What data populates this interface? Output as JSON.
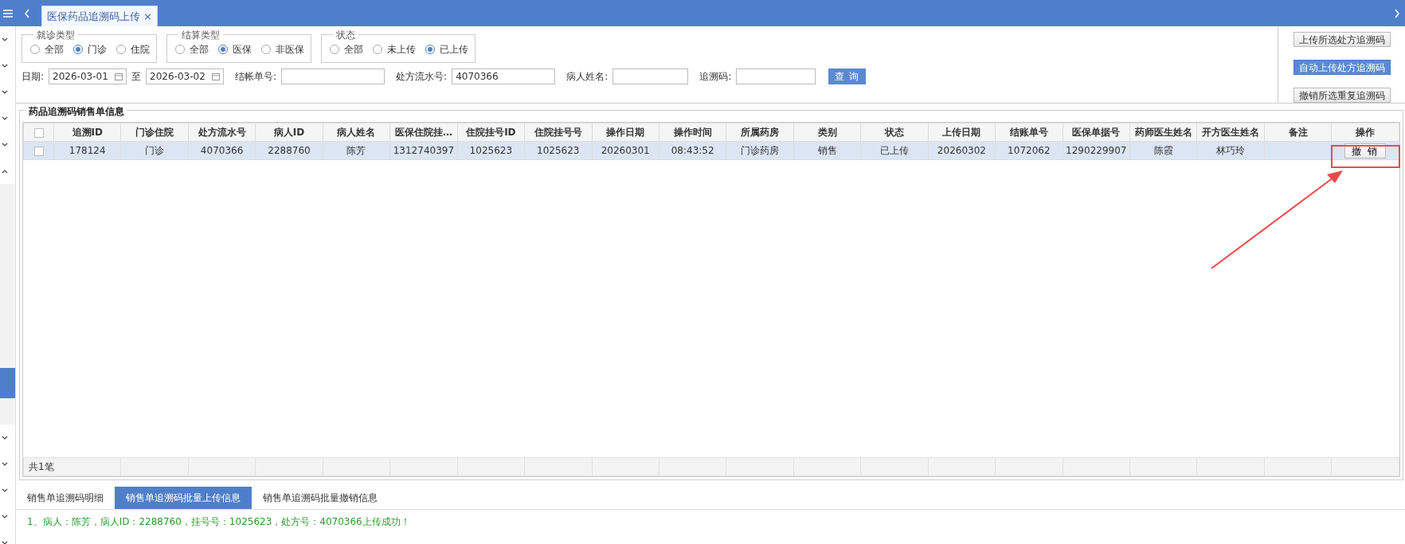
{
  "top_bar": {
    "tabs": [
      {
        "label": "医保药品追溯码上传",
        "close": "×",
        "selected": true
      }
    ]
  },
  "sidebar": {
    "items": [
      {
        "expanded": false
      },
      {
        "expanded": false
      },
      {
        "expanded": false
      },
      {
        "expanded": false
      },
      {
        "expanded": false
      },
      {
        "expanded": true,
        "children": [
          {
            "selected": true
          }
        ]
      },
      {
        "expanded": false
      },
      {
        "expanded": false
      },
      {
        "expanded": false
      },
      {
        "expanded": false
      },
      {
        "expanded": false
      }
    ]
  },
  "filters": {
    "groups": [
      {
        "legend": "就诊类型",
        "options": [
          {
            "label": "全部",
            "selected": false
          },
          {
            "label": "门诊",
            "selected": true
          },
          {
            "label": "住院",
            "selected": false
          }
        ]
      },
      {
        "legend": "结算类型",
        "options": [
          {
            "label": "全部",
            "selected": false
          },
          {
            "label": "医保",
            "selected": true
          },
          {
            "label": "非医保",
            "selected": false
          }
        ]
      },
      {
        "legend": "状态",
        "options": [
          {
            "label": "全部",
            "selected": false
          },
          {
            "label": "未上传",
            "selected": false
          },
          {
            "label": "已上传",
            "selected": true
          }
        ]
      }
    ],
    "fields": [
      {
        "kind": "date",
        "label": "日期:",
        "value": "2026-03-01"
      },
      {
        "kind": "date",
        "label": "至",
        "value": "2026-03-02"
      },
      {
        "kind": "text",
        "label": "结帐单号:"
      },
      {
        "kind": "text",
        "label": "处方流水号:",
        "value": "4070366"
      },
      {
        "kind": "text",
        "label": "病人姓名:"
      },
      {
        "kind": "text",
        "label": "追溯码:"
      }
    ],
    "query_button": "查 询"
  },
  "side_buttons": [
    {
      "label": "上传所选处方追溯码",
      "primary": false
    },
    {
      "label": "自动上传处方追溯码",
      "primary": true
    },
    {
      "label": "撤销所选重复追溯码",
      "primary": false
    }
  ],
  "grid": {
    "title": "药品追溯码销售单信息",
    "select_all_checked": false,
    "columns": [
      "追溯ID",
      "门诊住院",
      "处方流水号",
      "病人ID",
      "病人姓名",
      "医保住院挂…",
      "住院挂号ID",
      "住院挂号号",
      "操作日期",
      "操作时间",
      "所属药房",
      "类别",
      "状态",
      "上传日期",
      "结账单号",
      "医保单据号",
      "药师医生姓名",
      "开方医生姓名",
      "备注",
      "操作"
    ],
    "rows": [
      {
        "selected": true,
        "checked": false,
        "cells": [
          "178124",
          "门诊",
          "4070366",
          "2288760",
          "陈芳",
          "1312740397",
          "1025623",
          "1025623",
          "20260301",
          "08:43:52",
          "门诊药房",
          "销售",
          "已上传",
          "20260302",
          "1072062",
          "1290229907",
          "陈霞",
          "林巧玲",
          ""
        ],
        "action": "撤 销"
      }
    ],
    "footer": "共1笔"
  },
  "annotation": {
    "kind": "arrow-box"
  },
  "bottom_tabs": [
    {
      "label": "销售单追溯码明细",
      "selected": false
    },
    {
      "label": "销售单追溯码批量上传信息",
      "selected": true
    },
    {
      "label": "销售单追溯码批量撤销信息",
      "selected": false
    }
  ],
  "messages": [
    "1、病人：陈芳，病人ID：2288760，挂号号：1025623，处方号：4070366上传成功！"
  ]
}
